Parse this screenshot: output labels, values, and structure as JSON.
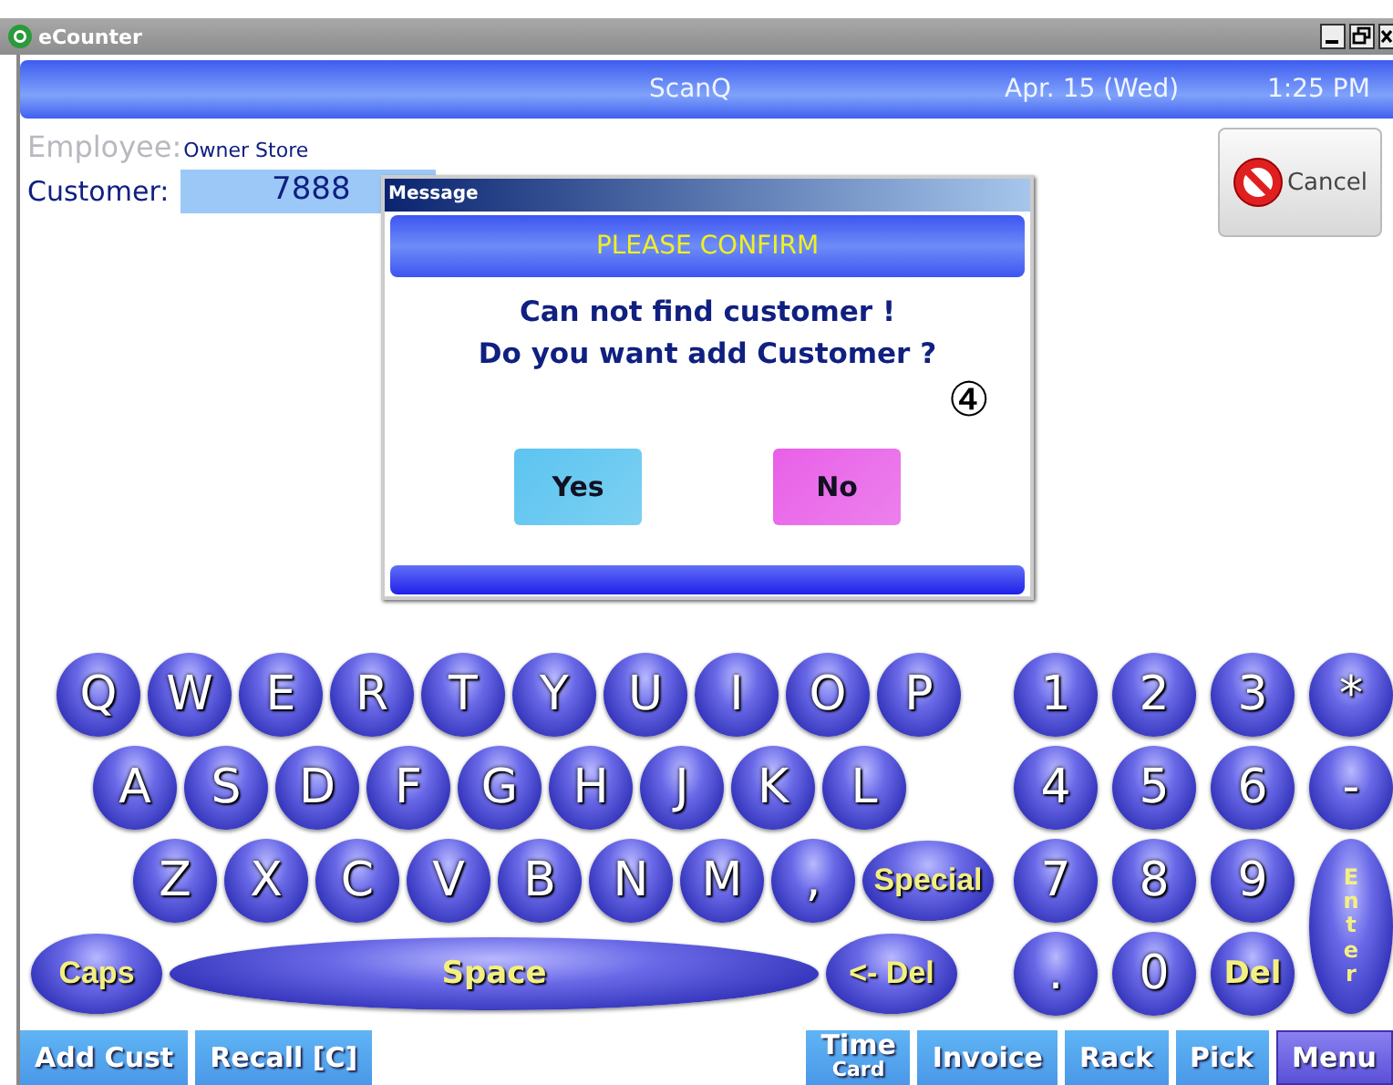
{
  "window": {
    "title": "eCounter"
  },
  "header": {
    "title": "ScanQ",
    "date": "Apr. 15 (Wed)",
    "time": "1:25 PM"
  },
  "employee": {
    "label": "Employee:",
    "value": "Owner Store",
    "disabled": true
  },
  "customer": {
    "label": "Customer:",
    "value": "7888",
    "disabled": false
  },
  "cancel_button": {
    "label": "Cancel"
  },
  "dialog": {
    "title": "Message",
    "banner": "PLEASE CONFIRM",
    "lines": [
      "Can not find customer !",
      "Do you want add Customer ?"
    ],
    "annotation": "④",
    "buttons": [
      {
        "label": "Yes",
        "color": "#5cc4f0"
      },
      {
        "label": "No",
        "color": "#e860e8"
      }
    ]
  },
  "keyboard": {
    "rows": [
      [
        {
          "label": "Q",
          "kind": "round"
        },
        {
          "label": "W",
          "kind": "round"
        },
        {
          "label": "E",
          "kind": "round"
        },
        {
          "label": "R",
          "kind": "round"
        },
        {
          "label": "T",
          "kind": "round"
        },
        {
          "label": "Y",
          "kind": "round"
        },
        {
          "label": "U",
          "kind": "round"
        },
        {
          "label": "I",
          "kind": "round"
        },
        {
          "label": "O",
          "kind": "round"
        },
        {
          "label": "P",
          "kind": "round"
        }
      ],
      [
        {
          "label": "A",
          "kind": "round"
        },
        {
          "label": "S",
          "kind": "round"
        },
        {
          "label": "D",
          "kind": "round"
        },
        {
          "label": "F",
          "kind": "round"
        },
        {
          "label": "G",
          "kind": "round"
        },
        {
          "label": "H",
          "kind": "round"
        },
        {
          "label": "J",
          "kind": "round"
        },
        {
          "label": "K",
          "kind": "round"
        },
        {
          "label": "L",
          "kind": "round"
        }
      ],
      [
        {
          "label": "Z",
          "kind": "round"
        },
        {
          "label": "X",
          "kind": "round"
        },
        {
          "label": "C",
          "kind": "round"
        },
        {
          "label": "V",
          "kind": "round"
        },
        {
          "label": "B",
          "kind": "round"
        },
        {
          "label": "N",
          "kind": "round"
        },
        {
          "label": "M",
          "kind": "round"
        },
        {
          "label": ",",
          "kind": "round"
        },
        {
          "label": "Special",
          "kind": "oval"
        }
      ]
    ],
    "bottom_keys": [
      {
        "label": "Caps",
        "kind": "oval"
      },
      {
        "label": "Space",
        "kind": "space"
      },
      {
        "label": "<- Del",
        "kind": "oval"
      }
    ],
    "numpad": [
      {
        "label": "1",
        "kind": "round"
      },
      {
        "label": "2",
        "kind": "round"
      },
      {
        "label": "3",
        "kind": "round"
      },
      {
        "label": "*",
        "kind": "round"
      },
      {
        "label": "4",
        "kind": "round"
      },
      {
        "label": "5",
        "kind": "round"
      },
      {
        "label": "6",
        "kind": "round"
      },
      {
        "label": "-",
        "kind": "round"
      },
      {
        "label": "7",
        "kind": "round"
      },
      {
        "label": "8",
        "kind": "round"
      },
      {
        "label": "9",
        "kind": "round"
      },
      {
        "label": "Enter",
        "kind": "enter"
      },
      {
        "label": ".",
        "kind": "round"
      },
      {
        "label": "0",
        "kind": "round"
      },
      {
        "label": "Del",
        "kind": "small"
      }
    ]
  },
  "toolbar": {
    "left": [
      {
        "label": "Add Cust",
        "selected": false
      },
      {
        "label": "Recall [C]",
        "selected": false
      }
    ],
    "right": [
      {
        "label": "Time",
        "sublabel": "Card",
        "selected": false
      },
      {
        "label": "Invoice",
        "selected": false
      },
      {
        "label": "Rack",
        "selected": false
      },
      {
        "label": "Pick",
        "selected": false
      },
      {
        "label": "Menu",
        "selected": true
      }
    ]
  }
}
